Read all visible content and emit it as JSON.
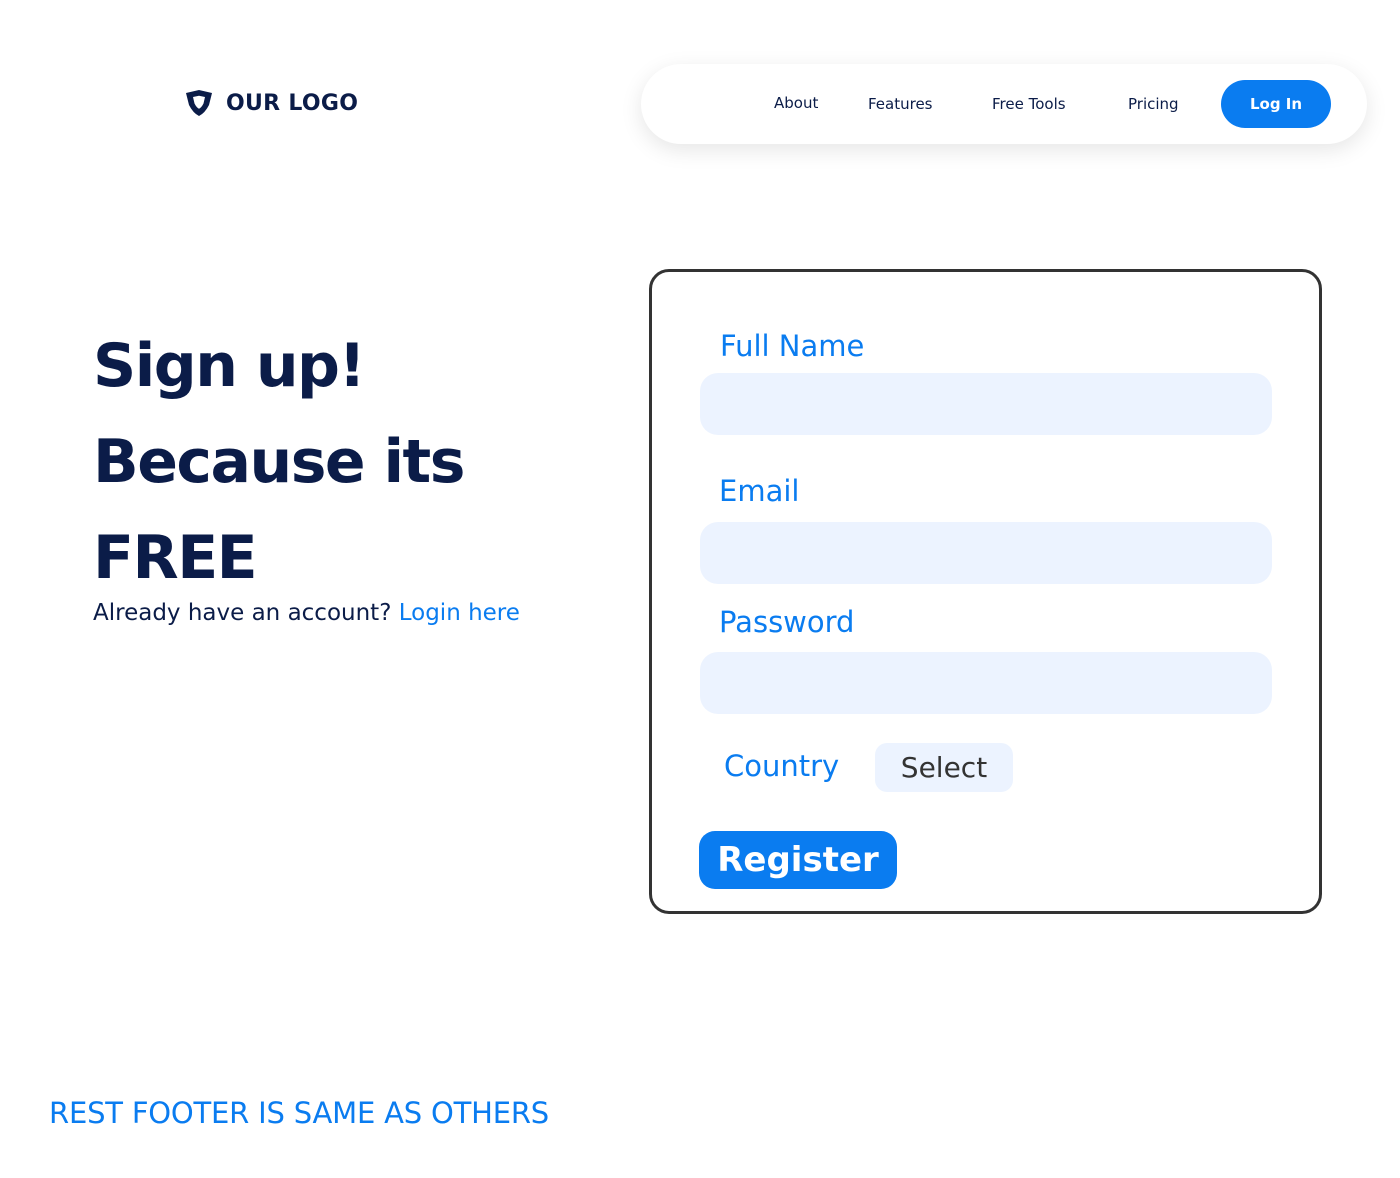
{
  "brand": {
    "logo_text": "OUR LOGO",
    "logo_icon": "shield-icon",
    "color_dark": "#0b1c48",
    "color_accent": "#0a7cf0"
  },
  "nav": {
    "items": [
      {
        "label": "About"
      },
      {
        "label": "Features"
      },
      {
        "label": "Free Tools"
      },
      {
        "label": "Pricing"
      }
    ],
    "login_label": "Log In"
  },
  "hero": {
    "line1": "Sign up!",
    "line2": "Because its",
    "line3": "FREE",
    "account_prompt": "Already have an account?",
    "login_link": "Login here"
  },
  "form": {
    "full_name_label": "Full Name",
    "full_name_value": "",
    "email_label": "Email",
    "email_value": "",
    "password_label": "Password",
    "password_value": "",
    "country_label": "Country",
    "country_select": "Select",
    "register_label": "Register"
  },
  "footer": {
    "note": "REST FOOTER IS SAME AS OTHERS"
  }
}
